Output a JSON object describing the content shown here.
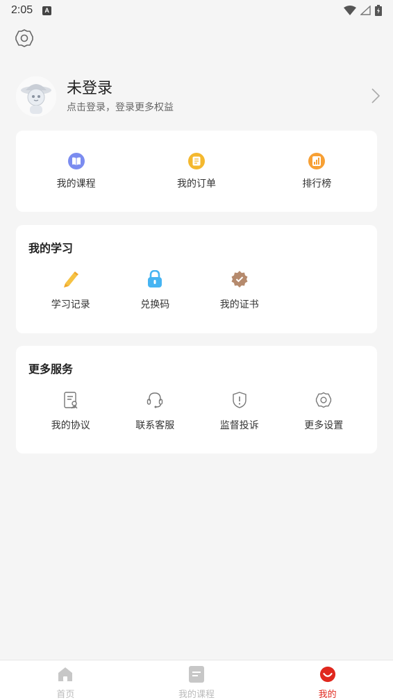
{
  "status_bar": {
    "time": "2:05",
    "badge": "A"
  },
  "profile": {
    "name": "未登录",
    "subtitle": "点击登录，登录更多权益"
  },
  "quick_links": [
    {
      "label": "我的课程",
      "icon": "book-icon",
      "color": "#7b8cf0"
    },
    {
      "label": "我的订单",
      "icon": "order-icon",
      "color": "#f4b82e"
    },
    {
      "label": "排行榜",
      "icon": "ranking-icon",
      "color": "#f7a035"
    }
  ],
  "my_learning": {
    "title": "我的学习",
    "items": [
      {
        "label": "学习记录",
        "icon": "pencil-icon",
        "color": "#f6c243"
      },
      {
        "label": "兑换码",
        "icon": "lock-icon",
        "color": "#46b4f2"
      },
      {
        "label": "我的证书",
        "icon": "certificate-icon",
        "color": "#b58a6d"
      }
    ]
  },
  "more_services": {
    "title": "更多服务",
    "items": [
      {
        "label": "我的协议",
        "icon": "agreement-icon"
      },
      {
        "label": "联系客服",
        "icon": "headset-icon"
      },
      {
        "label": "监督投诉",
        "icon": "shield-alert-icon"
      },
      {
        "label": "更多设置",
        "icon": "gear-icon"
      }
    ]
  },
  "tabbar": {
    "items": [
      {
        "label": "首页",
        "icon": "home-icon"
      },
      {
        "label": "我的课程",
        "icon": "courses-icon"
      },
      {
        "label": "我的",
        "icon": "profile-icon"
      }
    ],
    "active_index": 2,
    "active_color": "#e0281e"
  }
}
